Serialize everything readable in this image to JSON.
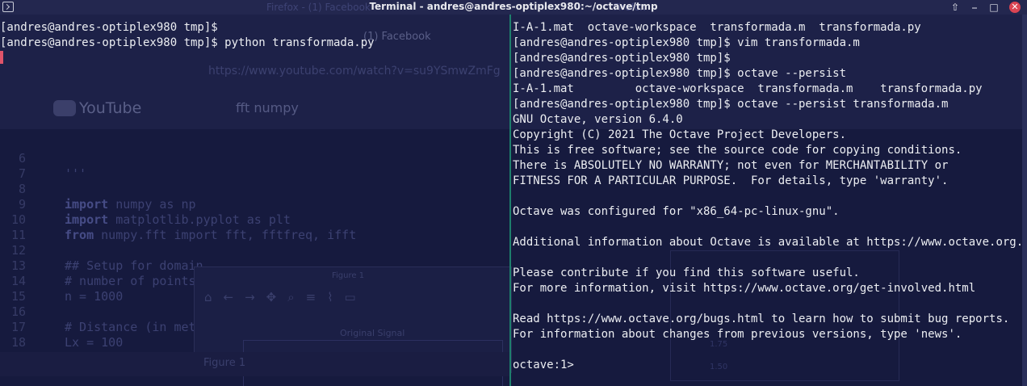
{
  "window": {
    "title": "Terminal - andres@andres-optiplex980:~/octave/tmp",
    "background_hint_left": "Firefox - (1) Facebook",
    "background_hint_right": "Firefox"
  },
  "window_buttons": {
    "keep_above": "⇧",
    "minimize": "⎯",
    "maximize": "□",
    "close": "✕"
  },
  "colors": {
    "background": "#161a3e",
    "divider": "#1e7f6c",
    "cursor": "#e0546a",
    "text": "#eceef2"
  },
  "left_pane": {
    "lines": [
      "[andres@andres-optiplex980 tmp]$",
      "[andres@andres-optiplex980 tmp]$ python transformada.py",
      ""
    ]
  },
  "right_pane": {
    "lines": [
      "I-A-1.mat  octave-workspace  transformada.m  transformada.py",
      "[andres@andres-optiplex980 tmp]$ vim transformada.m",
      "[andres@andres-optiplex980 tmp]$",
      "[andres@andres-optiplex980 tmp]$ octave --persist",
      "I-A-1.mat         octave-workspace  transformada.m    transformada.py",
      "[andres@andres-optiplex980 tmp]$ octave --persist transformada.m",
      "GNU Octave, version 6.4.0",
      "Copyright (C) 2021 The Octave Project Developers.",
      "This is free software; see the source code for copying conditions.",
      "There is ABSOLUTELY NO WARRANTY; not even for MERCHANTABILITY or",
      "FITNESS FOR A PARTICULAR PURPOSE.  For details, type 'warranty'.",
      "",
      "Octave was configured for \"x86_64-pc-linux-gnu\".",
      "",
      "Additional information about Octave is available at https://www.octave.org.",
      "",
      "Please contribute if you find this software useful.",
      "For more information, visit https://www.octave.org/get-involved.html",
      "",
      "Read https://www.octave.org/bugs.html to learn how to submit bug reports.",
      "For information about changes from previous versions, type 'news'.",
      "",
      "octave:1>"
    ]
  },
  "ghost": {
    "browser_tab": "(1) Facebook",
    "url": "https://www.youtube.com/watch?v=su9YSmwZmFg",
    "youtube_logo": "YouTube",
    "search_query": "fft numpy",
    "code_lines": [
      {
        "n": "6",
        "text": ""
      },
      {
        "n": "7",
        "text": "'''"
      },
      {
        "n": "8",
        "text": ""
      },
      {
        "n": "9",
        "kw": "import",
        "text": " numpy as np"
      },
      {
        "n": "10",
        "kw": "import",
        "text": " matplotlib.pyplot as plt"
      },
      {
        "n": "11",
        "kw": "from",
        "text": " numpy.fft import fft, fftfreq, ifft"
      },
      {
        "n": "12",
        "text": ""
      },
      {
        "n": "13",
        "text": "## Setup for domain"
      },
      {
        "n": "14",
        "text": "# number of points"
      },
      {
        "n": "15",
        "text": "n = 1000"
      },
      {
        "n": "16",
        "text": ""
      },
      {
        "n": "17",
        "text": "# Distance (in met"
      },
      {
        "n": "18",
        "text": "Lx = 100"
      }
    ],
    "figure_title": "Figure 1",
    "plot_title": "Original Signal",
    "taskbar_label": "Figure 1",
    "fig2_ticks": [
      "1.75",
      "1.50"
    ]
  }
}
